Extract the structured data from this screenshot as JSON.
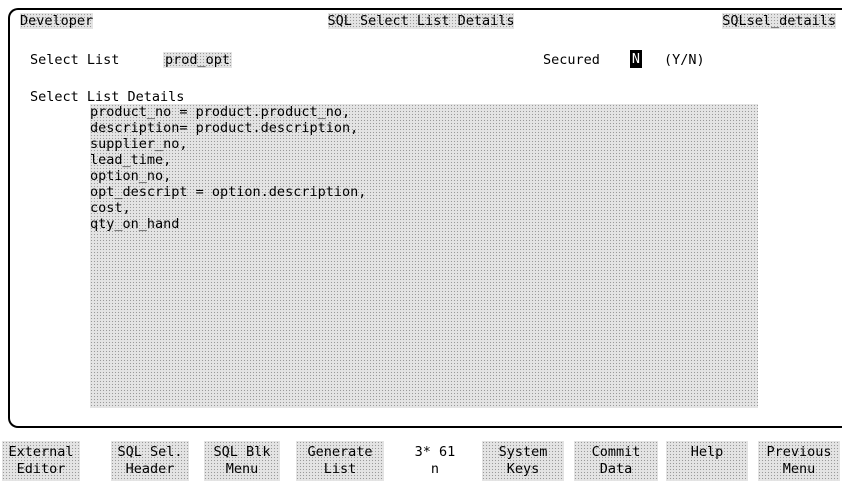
{
  "header": {
    "left": "Developer",
    "title": "SQL Select List Details",
    "right": "SQLsel_details"
  },
  "form": {
    "select_list_label": "Select List",
    "select_list_value": "prod_opt",
    "secured_label": "Secured",
    "secured_value": "N",
    "secured_hint": "(Y/N)",
    "details_label": "Select List Details",
    "details_lines": [
      "product_no = product.product_no,",
      "description= product.description,",
      "supplier_no,",
      "lead_time,",
      "option_no,",
      "opt_descript = option.description,",
      "cost,",
      "qty_on_hand"
    ]
  },
  "function_keys": [
    {
      "line1": "External",
      "line2": "Editor"
    },
    {
      "line1": "SQL Sel.",
      "line2": "Header"
    },
    {
      "line1": "SQL Blk",
      "line2": "Menu"
    },
    {
      "line1": "Generate",
      "line2": "List"
    },
    {
      "line1": "3* 61",
      "line2": "n"
    },
    {
      "line1": "System",
      "line2": "Keys"
    },
    {
      "line1": "Commit",
      "line2": "Data"
    },
    {
      "line1": "Help",
      "line2": ""
    },
    {
      "line1": "Previous",
      "line2": "Menu"
    }
  ]
}
